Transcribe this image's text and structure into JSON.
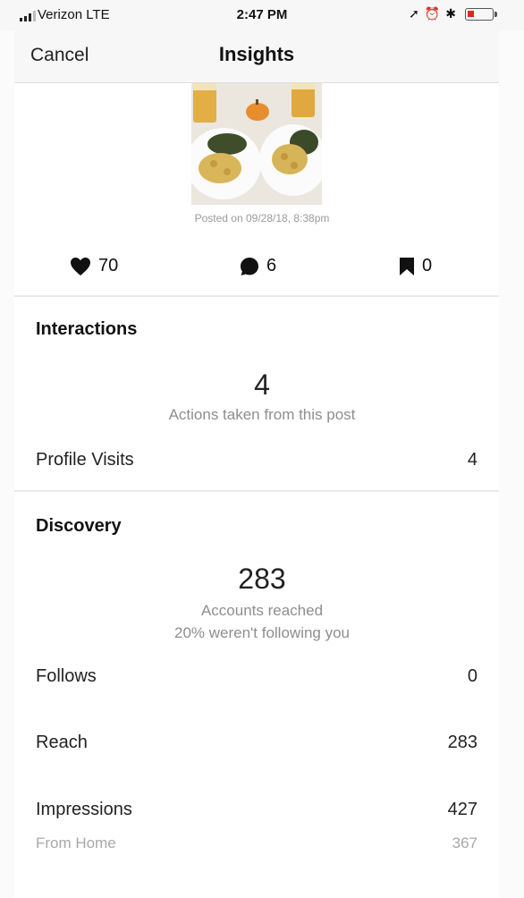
{
  "status_bar": {
    "carrier": "Verizon  LTE",
    "time": "2:47 PM",
    "icons": [
      "location-icon",
      "alarm-icon",
      "bluetooth-icon",
      "battery-icon"
    ]
  },
  "nav": {
    "cancel_label": "Cancel",
    "title": "Insights"
  },
  "post": {
    "posted_on": "Posted on 09/28/18, 8:38pm"
  },
  "counts": {
    "likes": "70",
    "comments": "6",
    "saves": "0"
  },
  "interactions": {
    "title": "Interactions",
    "total": "4",
    "subtitle": "Actions taken from this post",
    "rows": [
      {
        "label": "Profile Visits",
        "value": "4"
      }
    ]
  },
  "discovery": {
    "title": "Discovery",
    "total": "283",
    "subtitle": "Accounts reached",
    "subtitle2": "20% weren't following you",
    "rows": [
      {
        "label": "Follows",
        "value": "0"
      },
      {
        "label": "Reach",
        "value": "283"
      },
      {
        "label": "Impressions",
        "value": "427"
      }
    ],
    "subrows": [
      {
        "label": "From Home",
        "value": "367"
      }
    ]
  },
  "colors": {
    "accent_battery": "#e2261b",
    "text_secondary": "#8e8e8e"
  }
}
